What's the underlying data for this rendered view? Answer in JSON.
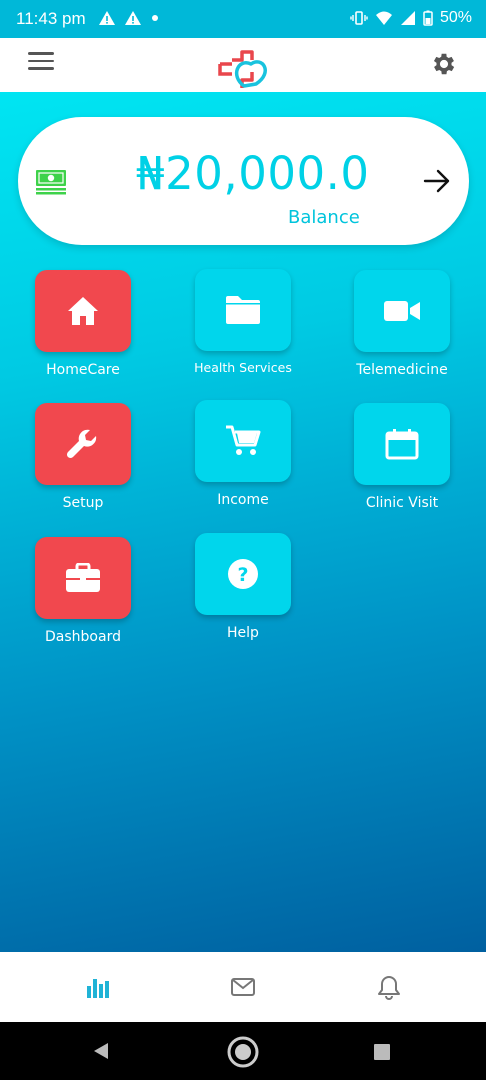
{
  "status": {
    "time": "11:43 pm",
    "battery": "50%"
  },
  "header": {
    "menu_icon": "hamburger-menu-icon",
    "logo_icon": "heart-cross-logo-icon",
    "settings_icon": "gear-icon"
  },
  "balance": {
    "amount": "₦20,000.0",
    "label": "Balance"
  },
  "tiles": [
    {
      "label": "HomeCare",
      "icon": "home-icon",
      "color": "#f1484e"
    },
    {
      "label": "Health Services",
      "icon": "folder-icon",
      "color": "#00d6ec"
    },
    {
      "label": "Telemedicine",
      "icon": "video-camera-icon",
      "color": "#00d6ec"
    },
    {
      "label": "Setup",
      "icon": "wrench-icon",
      "color": "#f1484e"
    },
    {
      "label": "Income",
      "icon": "cart-icon",
      "color": "#00d6ec"
    },
    {
      "label": "Clinic Visit",
      "icon": "calendar-icon",
      "color": "#00d6ec"
    },
    {
      "label": "Dashboard",
      "icon": "briefcase-icon",
      "color": "#f1484e"
    },
    {
      "label": "Help",
      "icon": "help-question-icon",
      "color": "#00d6ec"
    }
  ],
  "bottom_nav": [
    "bar-chart-icon",
    "mail-icon",
    "bell-icon"
  ],
  "colors": {
    "accent": "#00d1e6",
    "tile_red": "#f1484e",
    "tile_cyan": "#00d6ec"
  }
}
